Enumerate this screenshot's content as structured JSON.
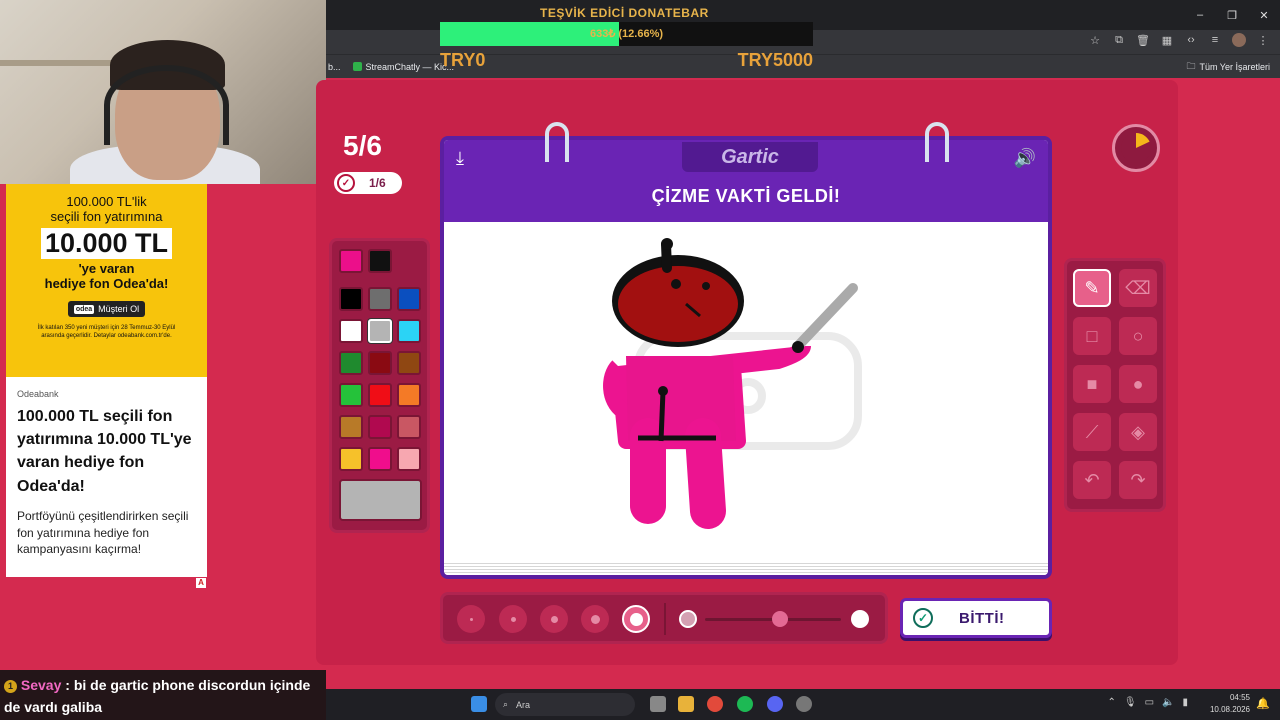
{
  "browser": {
    "bookmark_item": "StreamChatly — Kic...",
    "bookmark_prefix": "b...",
    "all_bookmarks": "Tüm Yer İşaretleri"
  },
  "donate": {
    "title": "TEŞVİK EDİCİ DONATEBAR",
    "amount": "633₺ (12.66%)",
    "progress_pct": 12.66,
    "min_label": "TRY0",
    "max_label": "TRY5000"
  },
  "ad": {
    "top_line1": "100.000 TL'lik",
    "top_line2": "seçili fon yatırımına",
    "big_amount": "10.000 TL",
    "top_line3": "'ye varan",
    "top_line4": "hediye fon Odea'da!",
    "cta_logo": "odea",
    "cta_label": "Müşteri Ol",
    "fine_print": "İlk katılan 350 yeni müşteri için 28 Temmuz-30 Eylül arasında geçerlidir. Detaylar odeabank.com.tr'de.",
    "brand": "Odeabank",
    "headline": "100.000 TL seçili fon yatırımına 10.000 TL'ye varan hediye fon Odea'da!",
    "description": "Portföyünü çeşitlendirirken seçili fon yatırımına hediye fon kampanyasını kaçırma!",
    "ad_flag": "A"
  },
  "game": {
    "round": "5/6",
    "done_count": "1/6",
    "logo": "Gartic",
    "title": "ÇİZME VAKTİ GELDİ!",
    "done_button": "BİTTİ!",
    "timer_remaining_fraction": 0.82,
    "palette": [
      "#ec0f8a",
      "#111111",
      "#000000",
      "#6e6e6e",
      "#0b4fbf",
      "#ffffff",
      "#b4b4b4",
      "#2bd3f5",
      "#1f8a2e",
      "#8a0a12",
      "#8f4712",
      "#25c23a",
      "#f00d16",
      "#f47a26",
      "#b87a28",
      "#b0094f",
      "#c95763",
      "#f6c12a",
      "#f00d8c",
      "#f7a7b0"
    ],
    "selected_color": "#b4b4b4",
    "opacity_level": 0.55,
    "selected_brush_size": 5
  },
  "chat": {
    "badge": "1",
    "username": "Sevay",
    "message": ": bi de gartic phone discordun içinde de vardı galiba"
  },
  "taskbar": {
    "search_placeholder": "Ara",
    "time": "04:55",
    "date": "10.08.2026"
  }
}
